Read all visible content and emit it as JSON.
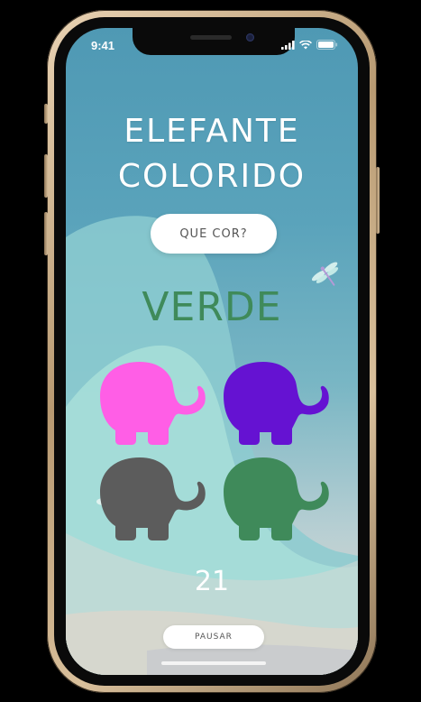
{
  "status_bar": {
    "time": "9:41"
  },
  "game": {
    "title_line1": "ELEFANTE",
    "title_line2": "COLORIDO",
    "question_label": "QUE COR?",
    "target_color_word": "VERDE",
    "target_color_hex": "#3f8a5a",
    "counter": "21",
    "pause_label": "PAUSAR"
  },
  "elephants": [
    {
      "color_name": "pink",
      "hex": "#ff5ee6"
    },
    {
      "color_name": "purple",
      "hex": "#6512d2"
    },
    {
      "color_name": "gray",
      "hex": "#5c5c5c"
    },
    {
      "color_name": "green",
      "hex": "#3f8a5a"
    }
  ],
  "icons": {
    "dragonfly": "dragonfly-icon",
    "signal": "signal-icon",
    "wifi": "wifi-icon",
    "battery": "battery-icon"
  }
}
